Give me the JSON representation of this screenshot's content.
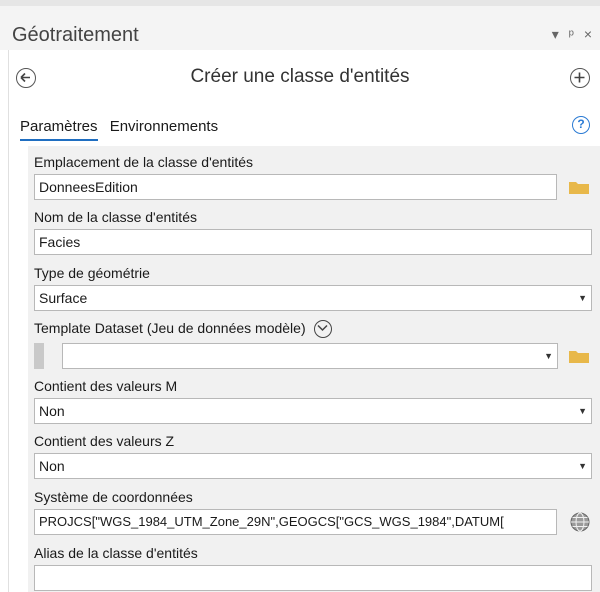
{
  "window": {
    "title": "Géotraitement",
    "controls": [
      "▾",
      "ᵖ",
      "×"
    ]
  },
  "tool": {
    "title": "Créer une classe d'entités"
  },
  "tabs": [
    {
      "label": "Paramètres",
      "active": true
    },
    {
      "label": "Environnements",
      "active": false
    }
  ],
  "params": {
    "location": {
      "label": "Emplacement de la classe d'entités",
      "value": "DonneesEdition"
    },
    "name": {
      "label": "Nom de la classe d'entités",
      "value": "Facies"
    },
    "geometry": {
      "label": "Type de géométrie",
      "value": "Surface"
    },
    "template": {
      "label": "Template Dataset (Jeu de données modèle)",
      "value": ""
    },
    "has_m": {
      "label": "Contient des valeurs M",
      "value": "Non"
    },
    "has_z": {
      "label": "Contient des valeurs Z",
      "value": "Non"
    },
    "crs": {
      "label": "Système de coordonnées",
      "value": "PROJCS[\"WGS_1984_UTM_Zone_29N\",GEOGCS[\"GCS_WGS_1984\",DATUM["
    },
    "alias": {
      "label": "Alias de la classe d'entités",
      "value": ""
    }
  },
  "colors": {
    "accent": "#1f6ec1",
    "folder": "#e8b84a",
    "panel": "#f1f1f1"
  },
  "icons": [
    "back-arrow-icon",
    "add-icon",
    "help-icon",
    "folder-icon",
    "expand-icon",
    "globe-icon",
    "dropdown-arrow-icon"
  ]
}
